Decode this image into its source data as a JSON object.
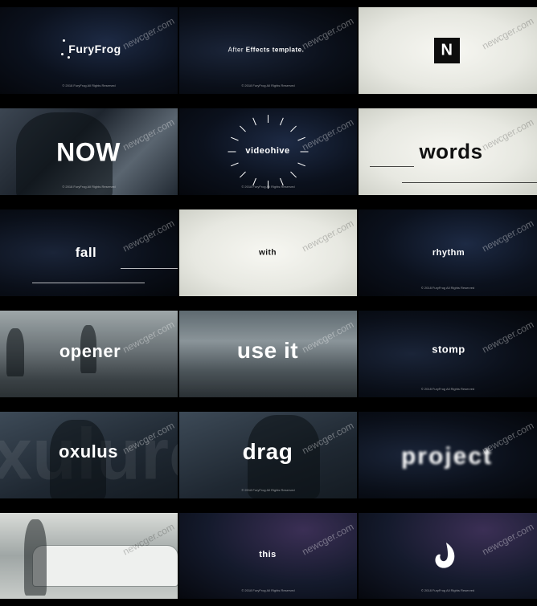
{
  "watermark": "newcger.com",
  "copyright": "© 2018 FuryFrog All Rights Reserved",
  "frames": [
    {
      "title": "FuryFrog"
    },
    {
      "title_a": "After",
      "title_b": " Effects template."
    },
    {
      "title": "N"
    },
    {
      "title": "NOW"
    },
    {
      "title": "videohive"
    },
    {
      "title": "words"
    },
    {
      "title": "fall"
    },
    {
      "title": "with"
    },
    {
      "title": "rhythm"
    },
    {
      "title": "opener"
    },
    {
      "title": "use it"
    },
    {
      "title": "stomp"
    },
    {
      "title": "oxulus",
      "bg_text": "xulurc"
    },
    {
      "title": "drag"
    },
    {
      "title": "project"
    },
    {
      "title": ""
    },
    {
      "title": "this"
    },
    {
      "title": ""
    }
  ]
}
